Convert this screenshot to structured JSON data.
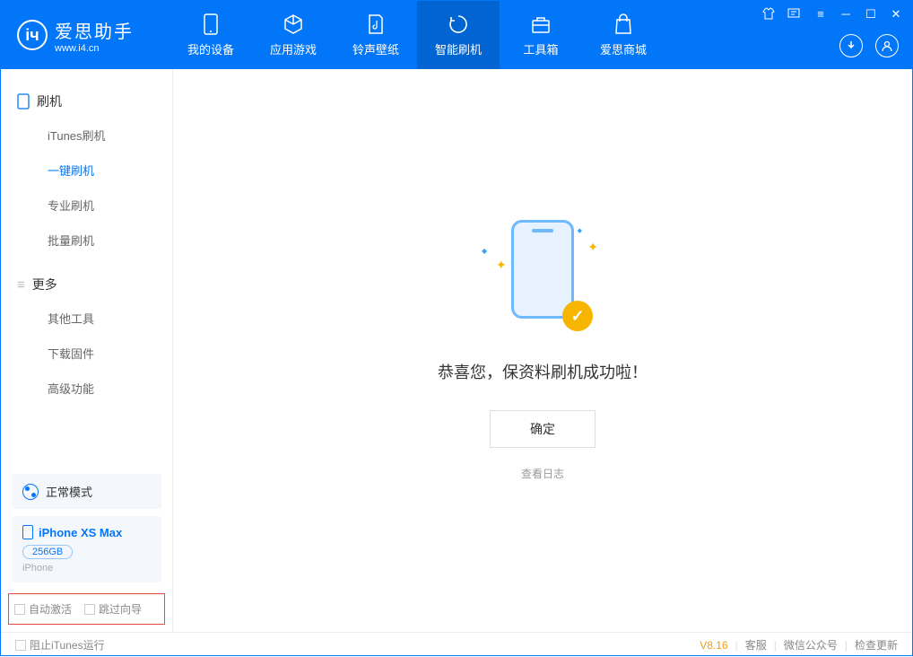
{
  "brand": {
    "name": "爱思助手",
    "url": "www.i4.cn"
  },
  "tabs": {
    "device": "我的设备",
    "apps": "应用游戏",
    "ringtone": "铃声壁纸",
    "flash": "智能刷机",
    "toolbox": "工具箱",
    "store": "爱思商城"
  },
  "sidebar": {
    "section1": {
      "title": "刷机",
      "items": [
        "iTunes刷机",
        "一键刷机",
        "专业刷机",
        "批量刷机"
      ]
    },
    "section2": {
      "title": "更多",
      "items": [
        "其他工具",
        "下载固件",
        "高级功能"
      ]
    }
  },
  "mode": {
    "label": "正常模式"
  },
  "device": {
    "name": "iPhone XS Max",
    "storage": "256GB",
    "type": "iPhone"
  },
  "options": {
    "auto_activate": "自动激活",
    "skip_guide": "跳过向导"
  },
  "main": {
    "success": "恭喜您，保资料刷机成功啦！",
    "ok": "确定",
    "view_log": "查看日志"
  },
  "footer": {
    "block_itunes": "阻止iTunes运行",
    "version": "V8.16",
    "support": "客服",
    "wechat": "微信公众号",
    "update": "检查更新"
  }
}
